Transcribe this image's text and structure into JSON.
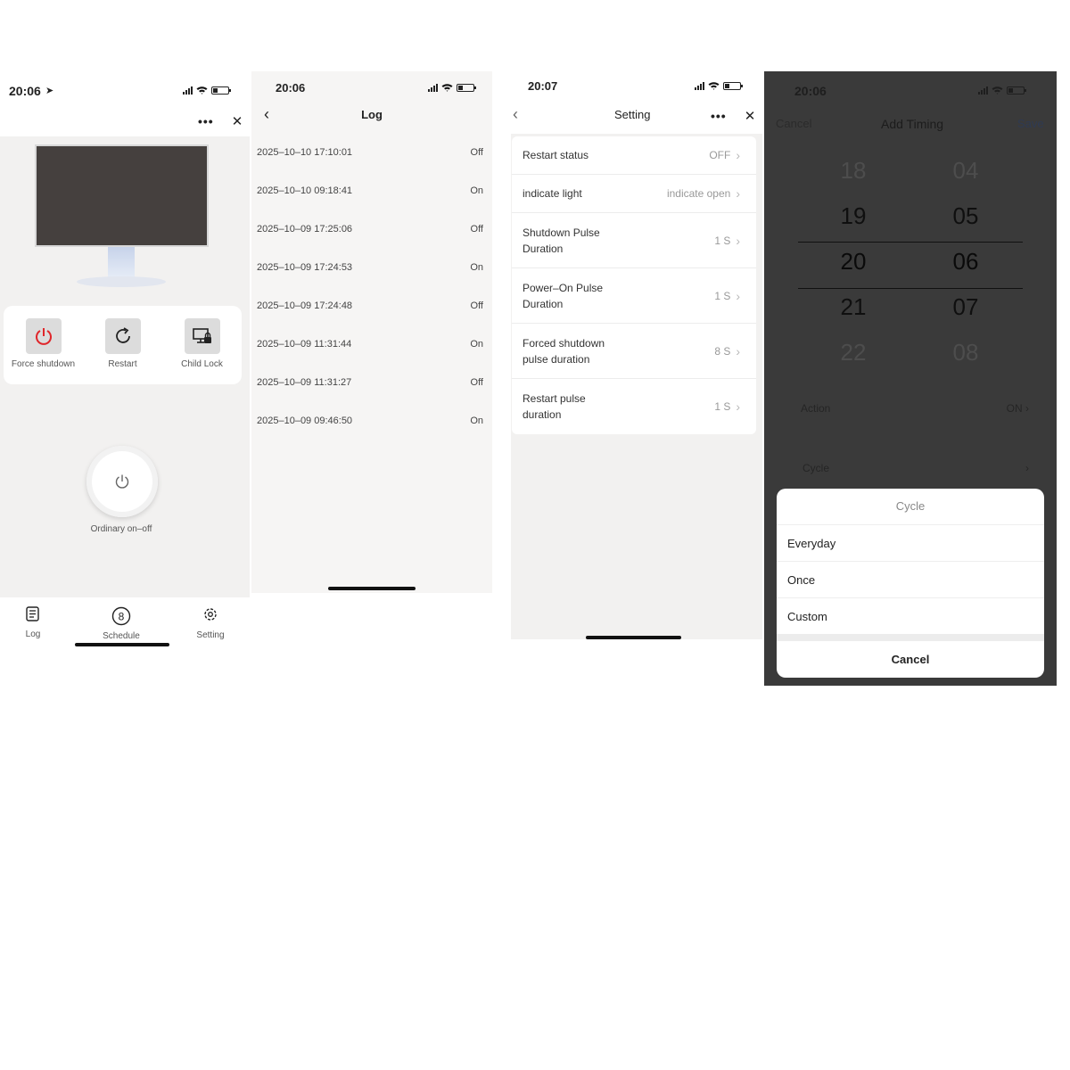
{
  "home": {
    "time": "20:06",
    "actions": [
      {
        "label": "Force shutdown",
        "icon": "power-icon"
      },
      {
        "label": "Restart",
        "icon": "restart-icon"
      },
      {
        "label": "Child Lock",
        "icon": "child-lock-icon"
      }
    ],
    "power_label": "Ordinary on–off",
    "tabs": [
      {
        "label": "Log",
        "icon": "log-icon"
      },
      {
        "label": "Schedule",
        "icon": "schedule-icon"
      },
      {
        "label": "Setting",
        "icon": "gear-icon"
      }
    ],
    "accent_color": "#e0262b"
  },
  "log": {
    "time": "20:06",
    "title": "Log",
    "entries": [
      {
        "timestamp": "2025–10–10 17:10:01",
        "state": "Off"
      },
      {
        "timestamp": "2025–10–10 09:18:41",
        "state": "On"
      },
      {
        "timestamp": "2025–10–09 17:25:06",
        "state": "Off"
      },
      {
        "timestamp": "2025–10–09 17:24:53",
        "state": "On"
      },
      {
        "timestamp": "2025–10–09 17:24:48",
        "state": "Off"
      },
      {
        "timestamp": "2025–10–09 11:31:44",
        "state": "On"
      },
      {
        "timestamp": "2025–10–09 11:31:27",
        "state": "Off"
      },
      {
        "timestamp": "2025–10–09 09:46:50",
        "state": "On"
      }
    ]
  },
  "setting": {
    "time": "20:07",
    "title": "Setting",
    "rows": [
      {
        "label_lines": [
          "Restart status"
        ],
        "value": "OFF"
      },
      {
        "label_lines": [
          "indicate light"
        ],
        "value": "indicate open"
      },
      {
        "label_lines": [
          "Shutdown Pulse",
          "Duration"
        ],
        "value": "1 S"
      },
      {
        "label_lines": [
          "Power–On Pulse",
          "Duration"
        ],
        "value": "1 S"
      },
      {
        "label_lines": [
          "Forced shutdown",
          "pulse duration"
        ],
        "value": "8 S"
      },
      {
        "label_lines": [
          "Restart pulse",
          "duration"
        ],
        "value": "1 S"
      }
    ]
  },
  "timing": {
    "time": "20:06",
    "cancel": "Cancel",
    "title": "Add Timing",
    "save": "Save",
    "hours": [
      "18",
      "19",
      "20",
      "21",
      "22"
    ],
    "minutes": [
      "04",
      "05",
      "06",
      "07",
      "08"
    ],
    "action_label": "Action",
    "action_value": "ON",
    "cycle_label": "Cycle",
    "sheet": {
      "title": "Cycle",
      "options": [
        "Everyday",
        "Once",
        "Custom"
      ],
      "cancel": "Cancel"
    }
  }
}
